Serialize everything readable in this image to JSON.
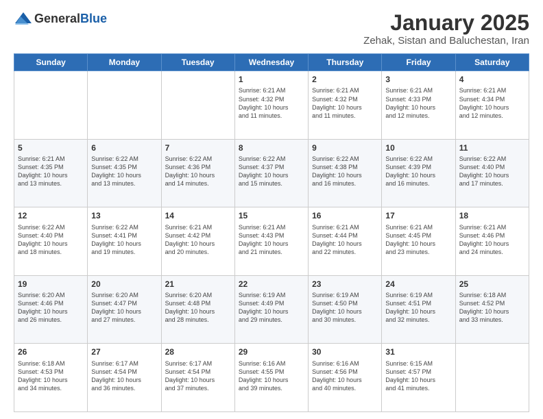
{
  "header": {
    "logo": {
      "general": "General",
      "blue": "Blue"
    },
    "title": "January 2025",
    "location": "Zehak, Sistan and Baluchestan, Iran"
  },
  "weekdays": [
    "Sunday",
    "Monday",
    "Tuesday",
    "Wednesday",
    "Thursday",
    "Friday",
    "Saturday"
  ],
  "weeks": [
    [
      {
        "day": "",
        "info": ""
      },
      {
        "day": "",
        "info": ""
      },
      {
        "day": "",
        "info": ""
      },
      {
        "day": "1",
        "info": "Sunrise: 6:21 AM\nSunset: 4:32 PM\nDaylight: 10 hours\nand 11 minutes."
      },
      {
        "day": "2",
        "info": "Sunrise: 6:21 AM\nSunset: 4:32 PM\nDaylight: 10 hours\nand 11 minutes."
      },
      {
        "day": "3",
        "info": "Sunrise: 6:21 AM\nSunset: 4:33 PM\nDaylight: 10 hours\nand 12 minutes."
      },
      {
        "day": "4",
        "info": "Sunrise: 6:21 AM\nSunset: 4:34 PM\nDaylight: 10 hours\nand 12 minutes."
      }
    ],
    [
      {
        "day": "5",
        "info": "Sunrise: 6:21 AM\nSunset: 4:35 PM\nDaylight: 10 hours\nand 13 minutes."
      },
      {
        "day": "6",
        "info": "Sunrise: 6:22 AM\nSunset: 4:35 PM\nDaylight: 10 hours\nand 13 minutes."
      },
      {
        "day": "7",
        "info": "Sunrise: 6:22 AM\nSunset: 4:36 PM\nDaylight: 10 hours\nand 14 minutes."
      },
      {
        "day": "8",
        "info": "Sunrise: 6:22 AM\nSunset: 4:37 PM\nDaylight: 10 hours\nand 15 minutes."
      },
      {
        "day": "9",
        "info": "Sunrise: 6:22 AM\nSunset: 4:38 PM\nDaylight: 10 hours\nand 16 minutes."
      },
      {
        "day": "10",
        "info": "Sunrise: 6:22 AM\nSunset: 4:39 PM\nDaylight: 10 hours\nand 16 minutes."
      },
      {
        "day": "11",
        "info": "Sunrise: 6:22 AM\nSunset: 4:40 PM\nDaylight: 10 hours\nand 17 minutes."
      }
    ],
    [
      {
        "day": "12",
        "info": "Sunrise: 6:22 AM\nSunset: 4:40 PM\nDaylight: 10 hours\nand 18 minutes."
      },
      {
        "day": "13",
        "info": "Sunrise: 6:22 AM\nSunset: 4:41 PM\nDaylight: 10 hours\nand 19 minutes."
      },
      {
        "day": "14",
        "info": "Sunrise: 6:21 AM\nSunset: 4:42 PM\nDaylight: 10 hours\nand 20 minutes."
      },
      {
        "day": "15",
        "info": "Sunrise: 6:21 AM\nSunset: 4:43 PM\nDaylight: 10 hours\nand 21 minutes."
      },
      {
        "day": "16",
        "info": "Sunrise: 6:21 AM\nSunset: 4:44 PM\nDaylight: 10 hours\nand 22 minutes."
      },
      {
        "day": "17",
        "info": "Sunrise: 6:21 AM\nSunset: 4:45 PM\nDaylight: 10 hours\nand 23 minutes."
      },
      {
        "day": "18",
        "info": "Sunrise: 6:21 AM\nSunset: 4:46 PM\nDaylight: 10 hours\nand 24 minutes."
      }
    ],
    [
      {
        "day": "19",
        "info": "Sunrise: 6:20 AM\nSunset: 4:46 PM\nDaylight: 10 hours\nand 26 minutes."
      },
      {
        "day": "20",
        "info": "Sunrise: 6:20 AM\nSunset: 4:47 PM\nDaylight: 10 hours\nand 27 minutes."
      },
      {
        "day": "21",
        "info": "Sunrise: 6:20 AM\nSunset: 4:48 PM\nDaylight: 10 hours\nand 28 minutes."
      },
      {
        "day": "22",
        "info": "Sunrise: 6:19 AM\nSunset: 4:49 PM\nDaylight: 10 hours\nand 29 minutes."
      },
      {
        "day": "23",
        "info": "Sunrise: 6:19 AM\nSunset: 4:50 PM\nDaylight: 10 hours\nand 30 minutes."
      },
      {
        "day": "24",
        "info": "Sunrise: 6:19 AM\nSunset: 4:51 PM\nDaylight: 10 hours\nand 32 minutes."
      },
      {
        "day": "25",
        "info": "Sunrise: 6:18 AM\nSunset: 4:52 PM\nDaylight: 10 hours\nand 33 minutes."
      }
    ],
    [
      {
        "day": "26",
        "info": "Sunrise: 6:18 AM\nSunset: 4:53 PM\nDaylight: 10 hours\nand 34 minutes."
      },
      {
        "day": "27",
        "info": "Sunrise: 6:17 AM\nSunset: 4:54 PM\nDaylight: 10 hours\nand 36 minutes."
      },
      {
        "day": "28",
        "info": "Sunrise: 6:17 AM\nSunset: 4:54 PM\nDaylight: 10 hours\nand 37 minutes."
      },
      {
        "day": "29",
        "info": "Sunrise: 6:16 AM\nSunset: 4:55 PM\nDaylight: 10 hours\nand 39 minutes."
      },
      {
        "day": "30",
        "info": "Sunrise: 6:16 AM\nSunset: 4:56 PM\nDaylight: 10 hours\nand 40 minutes."
      },
      {
        "day": "31",
        "info": "Sunrise: 6:15 AM\nSunset: 4:57 PM\nDaylight: 10 hours\nand 41 minutes."
      },
      {
        "day": "",
        "info": ""
      }
    ]
  ]
}
